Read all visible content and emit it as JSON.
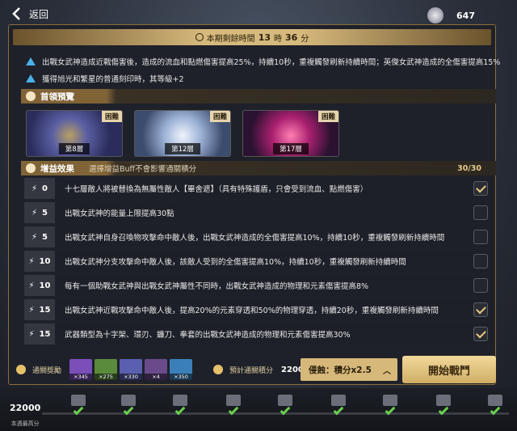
{
  "header": {
    "back_label": "返回",
    "currency": "647"
  },
  "timer": {
    "label": "本期剩餘時間",
    "hours": "13",
    "hour_unit": "時",
    "minutes": "36",
    "minute_unit": "分"
  },
  "notes": [
    "出戰女武神造成近戰傷害後，造成的流血和點燃傷害提高25%，持續10秒，重複觸發刷新持續時間；英傑女武神造成的全傷害提高15%",
    "獲得旭光和繁星的普通刻印時，其等級+2"
  ],
  "boss_section": {
    "title": "首領預覽"
  },
  "bosses": [
    {
      "difficulty": "困難",
      "floor": "第8層"
    },
    {
      "difficulty": "困難",
      "floor": "第12層"
    },
    {
      "difficulty": "困難",
      "floor": "第17層"
    }
  ],
  "buff_section": {
    "title": "增益效果",
    "hint": "選擇增益Buff不會影響通關積分",
    "count": "30/30"
  },
  "buffs": [
    {
      "cost": "0",
      "text": "十七層敵人將被替換為無屬性敵人【畢舍遮】（具有特殊護盾，只會受到流血、點燃傷害）",
      "checked": true
    },
    {
      "cost": "5",
      "text": "出戰女武神的能量上限提高30點",
      "checked": false
    },
    {
      "cost": "5",
      "text": "出戰女武神自身召喚物攻擊命中敵人後，出戰女武神造成的全傷害提高10%，持續10秒，重複觸發刷新持續時間",
      "checked": false
    },
    {
      "cost": "10",
      "text": "出戰女武神分支攻擊命中敵人後，該敵人受到的全傷害提高10%，持續10秒，重複觸發刷新持續時間",
      "checked": false
    },
    {
      "cost": "10",
      "text": "每有一個助戰女武神與出戰女武神屬性不同時，出戰女武神造成的物理和元素傷害提高8%",
      "checked": false
    },
    {
      "cost": "15",
      "text": "出戰女武神近戰攻擊命中敵人後，提高20%的元素穿透和50%的物理穿透，持續20秒，重複觸發刷新持續時間",
      "checked": true
    },
    {
      "cost": "15",
      "text": "武器類型為十字架、環刃、鐮刀、拳套的出戰女武神造成的物理和元素傷害提高30%",
      "checked": true
    }
  ],
  "reward": {
    "label": "通關獎勵",
    "items": [
      "×345",
      "×275",
      "×330",
      "×4",
      "×350"
    ]
  },
  "estimate": {
    "label": "預計通關積分",
    "value": "22000"
  },
  "erosion": {
    "label": "侵蝕：積分x2.5"
  },
  "start_label": "開始戰鬥",
  "progress": {
    "score": "22000",
    "score_label": "本週最高分"
  },
  "colors": {
    "accent": "#d6b87a",
    "check": "#6ad04c",
    "warning": "#4ab0e8"
  }
}
